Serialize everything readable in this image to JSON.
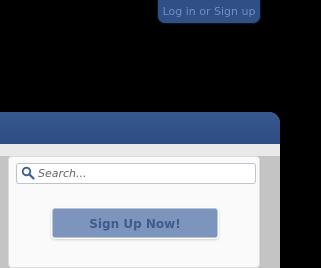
{
  "header": {
    "login_label": "Log in or Sign up"
  },
  "search": {
    "placeholder": "Search..."
  },
  "signup": {
    "label": "Sign Up Now!"
  }
}
